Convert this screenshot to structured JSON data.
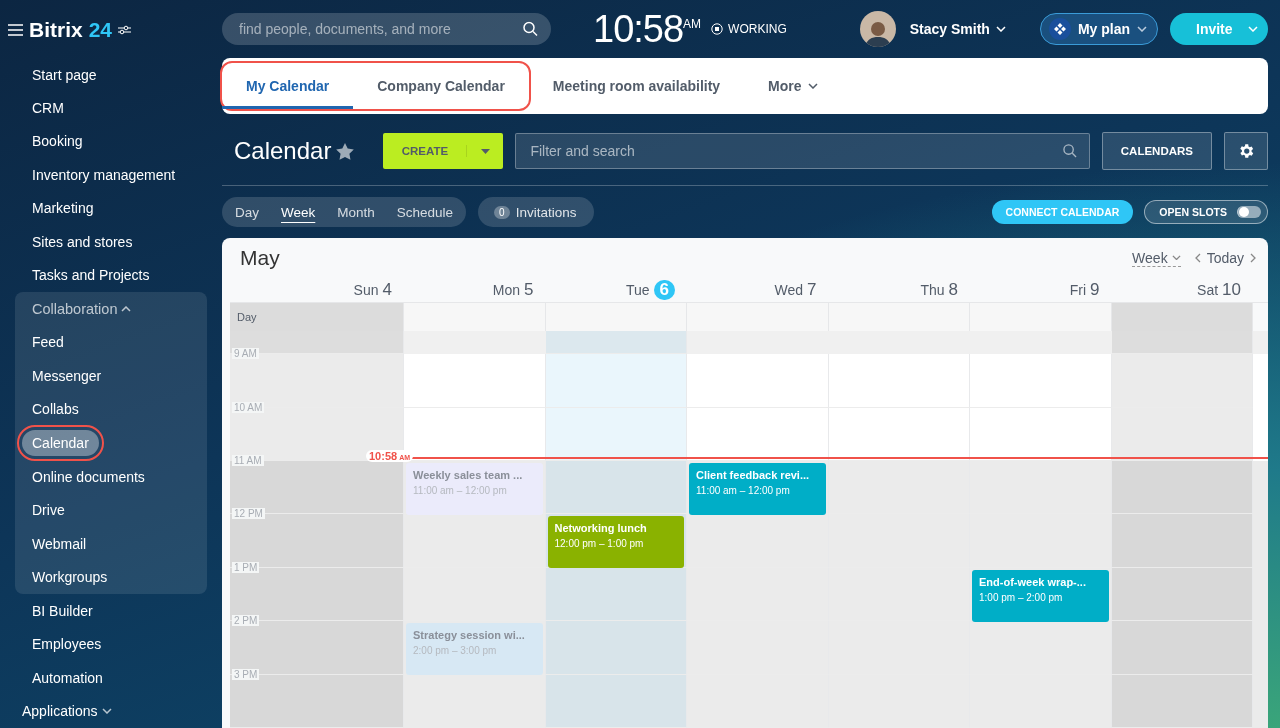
{
  "logo": {
    "name": "Bitrix",
    "number": "24"
  },
  "search": {
    "placeholder": "find people, documents, and more"
  },
  "clock": {
    "time": "10:58",
    "ampm": "AM",
    "status": "WORKING"
  },
  "user": {
    "name": "Stacy Smith"
  },
  "plan": {
    "label": "My plan"
  },
  "invite": {
    "label": "Invite"
  },
  "sidebar": {
    "items": [
      {
        "label": "Start page",
        "selected": false,
        "highlighted": false
      },
      {
        "label": "CRM",
        "selected": false,
        "highlighted": false
      },
      {
        "label": "Booking",
        "selected": false,
        "highlighted": false
      },
      {
        "label": "Inventory management",
        "selected": false,
        "highlighted": false
      },
      {
        "label": "Marketing",
        "selected": false,
        "highlighted": false
      },
      {
        "label": "Sites and stores",
        "selected": false,
        "highlighted": false
      },
      {
        "label": "Tasks and Projects",
        "selected": false,
        "highlighted": false
      },
      {
        "label": "Collaboration",
        "expanded": true,
        "children": [
          {
            "label": "Feed",
            "selected": false,
            "highlighted": false
          },
          {
            "label": "Messenger",
            "selected": false,
            "highlighted": false
          },
          {
            "label": "Collabs",
            "selected": false,
            "highlighted": false
          },
          {
            "label": "Calendar",
            "selected": true,
            "highlighted": true
          },
          {
            "label": "Online documents",
            "selected": false,
            "highlighted": false
          },
          {
            "label": "Drive",
            "selected": false,
            "highlighted": false
          },
          {
            "label": "Webmail",
            "selected": false,
            "highlighted": false
          },
          {
            "label": "Workgroups",
            "selected": false,
            "highlighted": false
          }
        ]
      },
      {
        "label": "BI Builder",
        "selected": false,
        "highlighted": false
      },
      {
        "label": "Employees",
        "selected": false,
        "highlighted": false
      },
      {
        "label": "Automation",
        "selected": false,
        "highlighted": false
      },
      {
        "label": "Applications",
        "expanded": false
      }
    ]
  },
  "top_tabs": [
    {
      "label": "My Calendar",
      "selected": true,
      "highlighted": true
    },
    {
      "label": "Company Calendar",
      "selected": false,
      "highlighted": true
    },
    {
      "label": "Meeting room availability",
      "selected": false,
      "highlighted": false
    },
    {
      "label": "More",
      "selected": false,
      "highlighted": false,
      "kind": "menu"
    }
  ],
  "toolbar": {
    "title": "Calendar",
    "create": "CREATE",
    "filter_placeholder": "Filter and search",
    "calendars": "CALENDARS"
  },
  "views": [
    {
      "label": "Day",
      "selected": false
    },
    {
      "label": "Week",
      "selected": true
    },
    {
      "label": "Month",
      "selected": false
    },
    {
      "label": "Schedule",
      "selected": false
    }
  ],
  "invitations": {
    "count": "0",
    "label": "Invitations"
  },
  "connect": "CONNECT CALENDAR",
  "open_slots": {
    "label": "OPEN SLOTS",
    "on": false
  },
  "calendar": {
    "month": "May",
    "view": "Week",
    "today": "Today",
    "days": [
      {
        "name": "Sun",
        "number": "4",
        "today": false,
        "weekend": true
      },
      {
        "name": "Mon",
        "number": "5",
        "today": false,
        "weekend": false
      },
      {
        "name": "Tue",
        "number": "6",
        "today": true,
        "weekend": false
      },
      {
        "name": "Wed",
        "number": "7",
        "today": false,
        "weekend": false
      },
      {
        "name": "Thu",
        "number": "8",
        "today": false,
        "weekend": false
      },
      {
        "name": "Fri",
        "number": "9",
        "today": false,
        "weekend": false
      },
      {
        "name": "Sat",
        "number": "10",
        "today": false,
        "weekend": true
      }
    ],
    "all_day_label": "Day",
    "rows": [
      {
        "label": "9 AM",
        "shaded": false,
        "cells": [
          [],
          [],
          [],
          [],
          [],
          [],
          []
        ]
      },
      {
        "label": "10 AM",
        "shaded": false,
        "now": {
          "time": "10:58",
          "ampm": "AM"
        },
        "cells": [
          [],
          [],
          [],
          [],
          [],
          [],
          []
        ]
      },
      {
        "label": "11 AM",
        "shaded": true,
        "cells": [
          [],
          [
            {
              "title": "Weekly sales team ...",
              "time": "11:00 am – 12:00 pm",
              "color": "#ebebfb",
              "dimmed": true
            }
          ],
          [],
          [
            {
              "title": "Client feedback revi...",
              "time": "11:00 am – 12:00 pm",
              "color": "#00aec7",
              "dimmed": false
            }
          ],
          [],
          [],
          []
        ]
      },
      {
        "label": "12 PM",
        "shaded": true,
        "cells": [
          [],
          [],
          [
            {
              "title": "Networking lunch",
              "time": "12:00 pm – 1:00 pm",
              "color": "#8ab200",
              "dimmed": false
            }
          ],
          [],
          [],
          [],
          []
        ]
      },
      {
        "label": "1 PM",
        "shaded": true,
        "cells": [
          [],
          [],
          [],
          [],
          [],
          [
            {
              "title": "End-of-week wrap-...",
              "time": "1:00 pm – 2:00 pm",
              "color": "#00aec7",
              "dimmed": false
            }
          ],
          []
        ]
      },
      {
        "label": "2 PM",
        "shaded": true,
        "cells": [
          [],
          [
            {
              "title": "Strategy session wi...",
              "time": "2:00 pm – 3:00 pm",
              "color": "#d7e8f4",
              "dimmed": true
            }
          ],
          [],
          [],
          [],
          [],
          []
        ]
      },
      {
        "label": "3 PM",
        "shaded": true,
        "cells": [
          [],
          [],
          [],
          [],
          [],
          [],
          []
        ]
      }
    ]
  }
}
